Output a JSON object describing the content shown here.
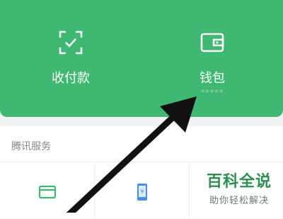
{
  "actions": {
    "pay": {
      "label": "收付款",
      "icon": "qr-scan-check-icon"
    },
    "wallet": {
      "label": "钱包",
      "sub": "*****",
      "icon": "wallet-icon"
    }
  },
  "services": {
    "title": "腾讯服务",
    "items": [
      {
        "icon": "card-icon"
      },
      {
        "icon": "phone-recharge-icon"
      },
      {
        "icon": "misc-icon"
      }
    ]
  },
  "watermark": {
    "title": "百科全说",
    "subtitle": "助你轻松解决"
  },
  "colors": {
    "brand_green": "#3fb871",
    "watermark_green": "#2d8f4d",
    "arrow": "#111111"
  }
}
